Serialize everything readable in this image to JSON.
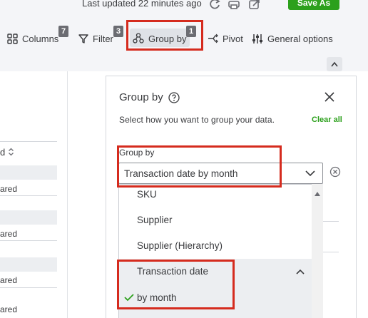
{
  "toolbar": {
    "last_updated": "Last updated 22 minutes ago",
    "save_as_label": "Save As",
    "columns_label": "Columns",
    "columns_count": "7",
    "filter_label": "Filter",
    "filter_count": "3",
    "group_by_label": "Group by",
    "group_by_count": "1",
    "pivot_label": "Pivot",
    "general_options_label": "General options",
    "icons": [
      "refresh-icon",
      "print-icon",
      "export-icon",
      "columns-icon",
      "filter-icon",
      "group-by-icon",
      "pivot-icon",
      "general-options-icon",
      "collapse-icon"
    ]
  },
  "table": {
    "header_fragment": "d",
    "row_fragments": [
      "ared",
      "ared",
      "ared",
      "ared"
    ]
  },
  "panel": {
    "title": "Group by",
    "description": "Select how you want to group your data.",
    "clear_all": "Clear all",
    "field_label": "Group by",
    "selected_value": "Transaction date by month",
    "options": [
      "SKU",
      "Supplier",
      "Supplier (Hierarchy)",
      "Transaction date",
      "by month"
    ],
    "checked_option": "by month"
  },
  "colors": {
    "brand_green": "#2ca01c",
    "highlight_red": "#d52b1e",
    "text": "#393a3d",
    "badge": "#6b6c72"
  }
}
